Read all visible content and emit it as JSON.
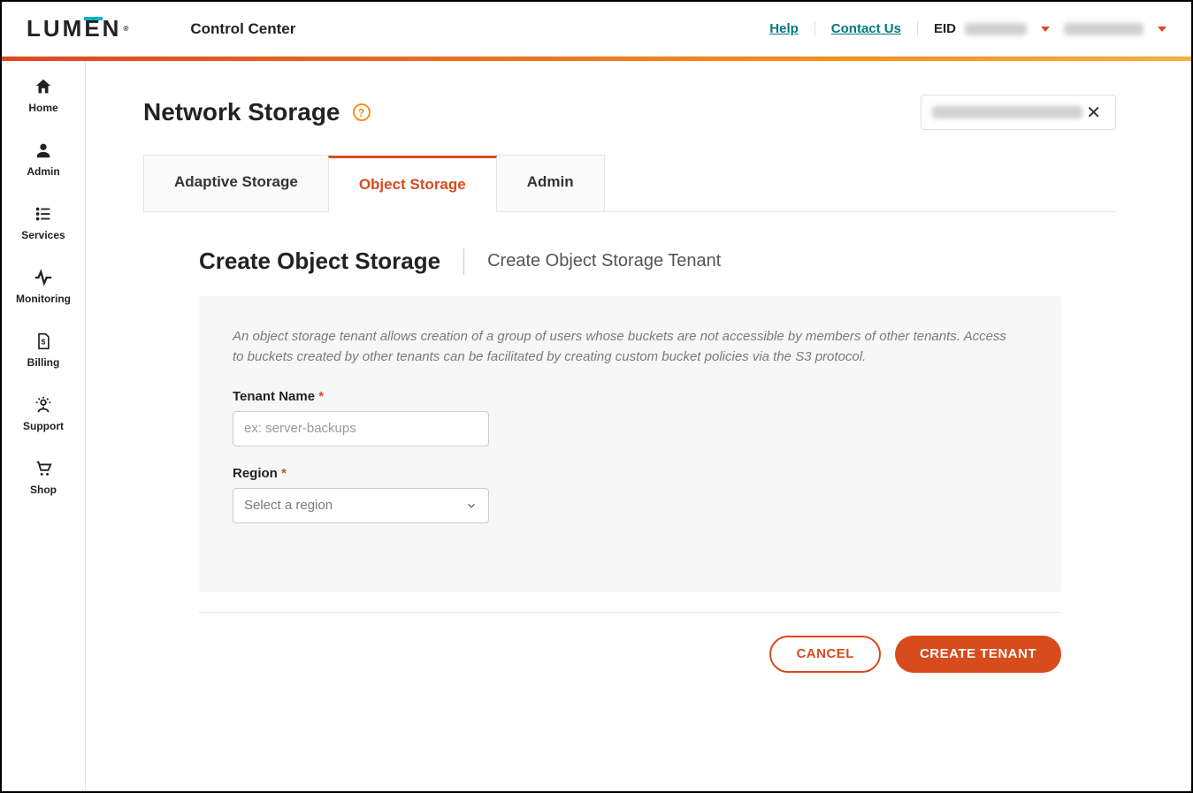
{
  "header": {
    "logo_text": "LUMEN",
    "app_name": "Control Center",
    "help": "Help",
    "contact": "Contact Us",
    "eid_prefix": "EID"
  },
  "sidebar": {
    "items": [
      {
        "label": "Home",
        "icon": "home-icon"
      },
      {
        "label": "Admin",
        "icon": "user-icon"
      },
      {
        "label": "Services",
        "icon": "list-icon"
      },
      {
        "label": "Monitoring",
        "icon": "pulse-icon"
      },
      {
        "label": "Billing",
        "icon": "invoice-icon"
      },
      {
        "label": "Support",
        "icon": "gear-user-icon"
      },
      {
        "label": "Shop",
        "icon": "cart-icon"
      }
    ]
  },
  "page": {
    "title": "Network Storage",
    "tabs": [
      {
        "label": "Adaptive Storage",
        "active": false
      },
      {
        "label": "Object Storage",
        "active": true
      },
      {
        "label": "Admin",
        "active": false
      }
    ]
  },
  "section": {
    "heading": "Create Object Storage",
    "breadcrumb": "Create Object Storage Tenant",
    "description": "An object storage tenant allows creation of a group of users whose buckets are not accessible by members of other tenants. Access to buckets created by other tenants can be facilitated by creating custom bucket policies via the S3 protocol.",
    "tenant_label": "Tenant Name",
    "tenant_placeholder": "ex: server-backups",
    "region_label": "Region",
    "region_placeholder": "Select a region"
  },
  "actions": {
    "cancel": "CANCEL",
    "create": "CREATE TENANT"
  }
}
